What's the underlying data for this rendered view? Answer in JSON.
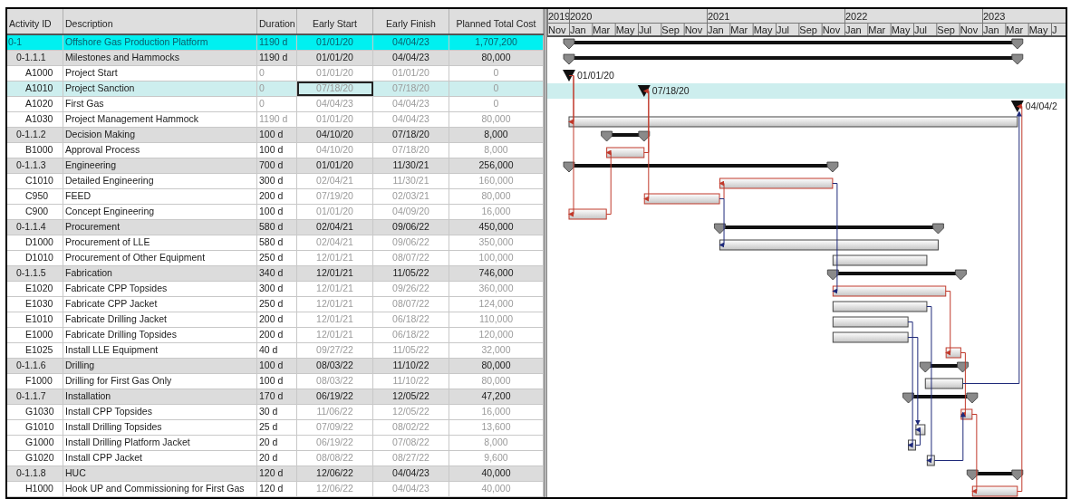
{
  "columns": [
    "Activity ID",
    "Description",
    "Duration",
    "Early Start",
    "Early Finish",
    "Planned Total Cost"
  ],
  "timeline": {
    "years": [
      "2019",
      "2020",
      "2021",
      "2022",
      "2023"
    ],
    "months": [
      "Nov",
      "Jan",
      "Mar",
      "May",
      "Jul",
      "Sep",
      "Nov",
      "Jan",
      "Mar",
      "May",
      "Jul",
      "Sep",
      "Nov",
      "Jan",
      "Mar",
      "May",
      "Jul",
      "Sep",
      "Nov",
      "Jan",
      "Mar",
      "May",
      "J"
    ]
  },
  "activities": [
    {
      "kind": "project",
      "id": "0-1",
      "description": "Offshore Gas Production Platform",
      "duration": "1190 d",
      "early_start": "01/01/20",
      "early_finish": "04/04/23",
      "cost": "1,707,200",
      "selected": false,
      "children": [
        {
          "kind": "wbs",
          "id": "0-1.1.1",
          "description": "Milestones and Hammocks",
          "duration": "1190 d",
          "early_start": "01/01/20",
          "early_finish": "04/04/23",
          "cost": "80,000",
          "selected": false,
          "children": [
            {
              "kind": "milestone",
              "id": "A1000",
              "description": "Project Start",
              "duration": "0",
              "early_start": "01/01/20",
              "early_finish": "01/01/20",
              "cost": "0",
              "selected": false,
              "bar_label": "01/01/20"
            },
            {
              "kind": "milestone",
              "id": "A1010",
              "description": "Project Sanction",
              "duration": "0",
              "early_start": "07/18/20",
              "early_finish": "07/18/20",
              "cost": "0",
              "selected": true,
              "focused": true,
              "bar_label": "07/18/20"
            },
            {
              "kind": "milestone",
              "id": "A1020",
              "description": "First Gas",
              "duration": "0",
              "early_start": "04/04/23",
              "early_finish": "04/04/23",
              "cost": "0",
              "selected": false,
              "bar_label": "04/04/2"
            },
            {
              "kind": "hammock",
              "id": "A1030",
              "description": "Project Management Hammock",
              "duration": "1190 d",
              "early_start": "01/01/20",
              "early_finish": "04/04/23",
              "cost": "80,000",
              "selected": false,
              "critical": false
            }
          ]
        },
        {
          "kind": "wbs",
          "id": "0-1.1.2",
          "description": "Decision Making",
          "duration": "100 d",
          "early_start": "04/10/20",
          "early_finish": "07/18/20",
          "cost": "8,000",
          "selected": false,
          "children": [
            {
              "kind": "task",
              "id": "B1000",
              "description": "Approval Process",
              "duration": "100 d",
              "early_start": "04/10/20",
              "early_finish": "07/18/20",
              "cost": "8,000",
              "selected": false,
              "critical": true
            }
          ]
        },
        {
          "kind": "wbs",
          "id": "0-1.1.3",
          "description": "Engineering",
          "duration": "700 d",
          "early_start": "01/01/20",
          "early_finish": "11/30/21",
          "cost": "256,000",
          "selected": false,
          "children": [
            {
              "kind": "task",
              "id": "C1010",
              "description": "Detailed Engineering",
              "duration": "300 d",
              "early_start": "02/04/21",
              "early_finish": "11/30/21",
              "cost": "160,000",
              "selected": false,
              "critical": true
            },
            {
              "kind": "task",
              "id": "C950",
              "description": "FEED",
              "duration": "200 d",
              "early_start": "07/19/20",
              "early_finish": "02/03/21",
              "cost": "80,000",
              "selected": false,
              "critical": true
            },
            {
              "kind": "task",
              "id": "C900",
              "description": "Concept Engineering",
              "duration": "100 d",
              "early_start": "01/01/20",
              "early_finish": "04/09/20",
              "cost": "16,000",
              "selected": false,
              "critical": true
            }
          ]
        },
        {
          "kind": "wbs",
          "id": "0-1.1.4",
          "description": "Procurement",
          "duration": "580 d",
          "early_start": "02/04/21",
          "early_finish": "09/06/22",
          "cost": "450,000",
          "selected": false,
          "children": [
            {
              "kind": "task",
              "id": "D1000",
              "description": "Procurement of LLE",
              "duration": "580 d",
              "early_start": "02/04/21",
              "early_finish": "09/06/22",
              "cost": "350,000",
              "selected": false,
              "critical": false
            },
            {
              "kind": "task",
              "id": "D1010",
              "description": "Procurement of Other Equipment",
              "duration": "250 d",
              "early_start": "12/01/21",
              "early_finish": "08/07/22",
              "cost": "100,000",
              "selected": false,
              "critical": false
            }
          ]
        },
        {
          "kind": "wbs",
          "id": "0-1.1.5",
          "description": "Fabrication",
          "duration": "340 d",
          "early_start": "12/01/21",
          "early_finish": "11/05/22",
          "cost": "746,000",
          "selected": false,
          "children": [
            {
              "kind": "task",
              "id": "E1020",
              "description": "Fabricate CPP Topsides",
              "duration": "300 d",
              "early_start": "12/01/21",
              "early_finish": "09/26/22",
              "cost": "360,000",
              "selected": false,
              "critical": true
            },
            {
              "kind": "task",
              "id": "E1030",
              "description": "Fabricate CPP Jacket",
              "duration": "250 d",
              "early_start": "12/01/21",
              "early_finish": "08/07/22",
              "cost": "124,000",
              "selected": false,
              "critical": false
            },
            {
              "kind": "task",
              "id": "E1010",
              "description": "Fabricate Drilling Jacket",
              "duration": "200 d",
              "early_start": "12/01/21",
              "early_finish": "06/18/22",
              "cost": "110,000",
              "selected": false,
              "critical": false
            },
            {
              "kind": "task",
              "id": "E1000",
              "description": "Fabricate Drilling Topsides",
              "duration": "200 d",
              "early_start": "12/01/21",
              "early_finish": "06/18/22",
              "cost": "120,000",
              "selected": false,
              "critical": false
            },
            {
              "kind": "task",
              "id": "E1025",
              "description": "Install LLE Equipment",
              "duration": "40 d",
              "early_start": "09/27/22",
              "early_finish": "11/05/22",
              "cost": "32,000",
              "selected": false,
              "critical": true
            }
          ]
        },
        {
          "kind": "wbs",
          "id": "0-1.1.6",
          "description": "Drilling",
          "duration": "100 d",
          "early_start": "08/03/22",
          "early_finish": "11/10/22",
          "cost": "80,000",
          "selected": false,
          "children": [
            {
              "kind": "task",
              "id": "F1000",
              "description": "Drilling for First Gas Only",
              "duration": "100 d",
              "early_start": "08/03/22",
              "early_finish": "11/10/22",
              "cost": "80,000",
              "selected": false,
              "critical": false
            }
          ]
        },
        {
          "kind": "wbs",
          "id": "0-1.1.7",
          "description": "Installation",
          "duration": "170 d",
          "early_start": "06/19/22",
          "early_finish": "12/05/22",
          "cost": "47,200",
          "selected": false,
          "children": [
            {
              "kind": "task",
              "id": "G1030",
              "description": "Install CPP Topsides",
              "duration": "30 d",
              "early_start": "11/06/22",
              "early_finish": "12/05/22",
              "cost": "16,000",
              "selected": false,
              "critical": true
            },
            {
              "kind": "task",
              "id": "G1010",
              "description": "Install Drilling Topsides",
              "duration": "25 d",
              "early_start": "07/09/22",
              "early_finish": "08/02/22",
              "cost": "13,600",
              "selected": false,
              "critical": false
            },
            {
              "kind": "task",
              "id": "G1000",
              "description": "Install Drilling Platform Jacket",
              "duration": "20 d",
              "early_start": "06/19/22",
              "early_finish": "07/08/22",
              "cost": "8,000",
              "selected": false,
              "critical": false
            },
            {
              "kind": "task",
              "id": "G1020",
              "description": "Install CPP Jacket",
              "duration": "20 d",
              "early_start": "08/08/22",
              "early_finish": "08/27/22",
              "cost": "9,600",
              "selected": false,
              "critical": false
            }
          ]
        },
        {
          "kind": "wbs",
          "id": "0-1.1.8",
          "description": "HUC",
          "duration": "120 d",
          "early_start": "12/06/22",
          "early_finish": "04/04/23",
          "cost": "40,000",
          "selected": false,
          "children": [
            {
              "kind": "task",
              "id": "H1000",
              "description": "Hook UP and Commissioning for First Gas",
              "duration": "120 d",
              "early_start": "12/06/22",
              "early_finish": "04/04/23",
              "cost": "40,000",
              "selected": false,
              "critical": true
            }
          ]
        }
      ]
    }
  ]
}
